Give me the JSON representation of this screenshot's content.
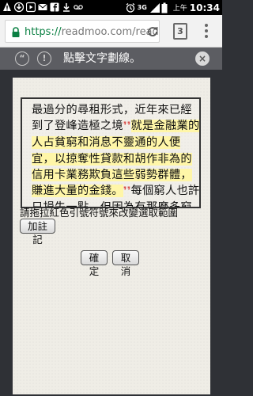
{
  "status_bar": {
    "network": "3G",
    "ampm": "上午",
    "time": "10:34",
    "icons": [
      "phone-alert-icon",
      "download-icon",
      "play-icon",
      "mail-icon",
      "facebook-icon",
      "download-icon",
      "voicemail-icon",
      "alarm-icon",
      "network-3g-icon",
      "signal-icon",
      "battery-icon"
    ]
  },
  "browser": {
    "url_scheme": "https://",
    "url_rest": "readmoo.com/read",
    "tab_count": "3"
  },
  "reader_bar": {
    "instruction": "點擊文字劃線。",
    "left_icon_1": "“",
    "left_icon_2": "!",
    "close": "×"
  },
  "content": {
    "text_before": "最過分的尋租形式，近年來已經到了登峰造極之境",
    "open_quote": "❜❜",
    "highlighted": "就是金融業的人占貧窮和消息不靈通的人便宜，以掠奪性貸款和胡作非為的信用卡業務欺負這些弱勢群體，賺進大量的金錢。",
    "close_quote": "❜❜",
    "text_after": "每個窮人也許只損失一點，但因為有那麼多窮人，每個人"
  },
  "hint": "請拖拉紅色引號符號來改變選取範圍",
  "buttons": {
    "add_note": "加註記",
    "confirm": "確定",
    "cancel": "取消"
  },
  "colors": {
    "highlight": "#fff6a8",
    "quote_marker": "#d9534f",
    "url_scheme": "#0b8043"
  }
}
